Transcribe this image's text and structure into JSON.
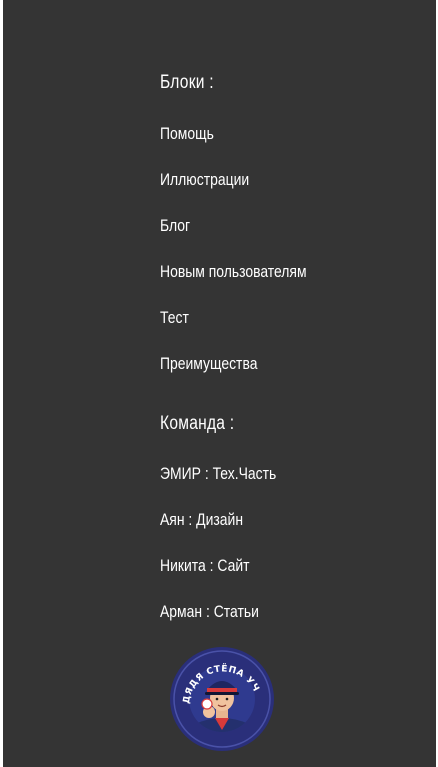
{
  "blocks": {
    "heading": "Блоки :",
    "items": [
      {
        "label": "Помощь"
      },
      {
        "label": "Иллюстрации"
      },
      {
        "label": "Блог"
      },
      {
        "label": "Новым пользователям"
      },
      {
        "label": "Тест"
      },
      {
        "label": "Преимущества"
      }
    ]
  },
  "team": {
    "heading": "Команда :",
    "members": [
      {
        "label": "ЭМИР : Тех.Часть"
      },
      {
        "label": "Аян : Дизайн"
      },
      {
        "label": "Никита : Сайт"
      },
      {
        "label": "Арман : Статьи"
      }
    ]
  },
  "logo": {
    "text": "ДЯДЯ СТЁПА УЧИТ ПДД",
    "icon": "uncle-styopa-logo"
  },
  "colors": {
    "background": "#343434",
    "text": "#ffffff",
    "logo_ring": "#2a2f7a"
  }
}
